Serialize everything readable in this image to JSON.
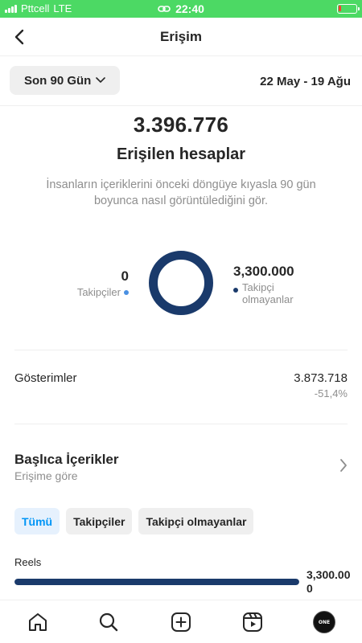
{
  "status_bar": {
    "carrier": "Pttcell",
    "network": "LTE",
    "time": "22:40",
    "link_icon": "link-icon",
    "battery_level": 0.08
  },
  "header": {
    "title": "Erişim",
    "back_icon": "back-chevron-icon"
  },
  "filter": {
    "range_label": "Son 90 Gün",
    "date_range": "22 May - 19 Ağu"
  },
  "summary": {
    "total": "3.396.776",
    "label": "Erişilen hesaplar",
    "description": "İnsanların içeriklerini önceki döngüye kıyasla 90 gün boyunca nasıl görüntülediğini gör."
  },
  "breakdown": {
    "followers_value": "0",
    "followers_label": "Takipçiler",
    "non_followers_value": "3,300.000",
    "non_followers_label": "Takipçi olmayanlar",
    "followers_color": "#4a90e2",
    "non_followers_color": "#1a3a6b"
  },
  "impressions": {
    "label": "Gösterimler",
    "value": "3.873.718",
    "change": "-51,4%"
  },
  "top_content": {
    "title": "Başlıca İçerikler",
    "subtitle": "Erişime göre"
  },
  "chips": [
    "Tümü",
    "Takipçiler",
    "Takipçi olmayanlar"
  ],
  "active_chip": "Tümü",
  "reels": {
    "label": "Reels",
    "value": "3,300.000",
    "fill_fraction": 1.0
  },
  "tab_bar": {
    "tabs": [
      "home-icon",
      "search-icon",
      "create-icon",
      "reels-icon",
      "profile-avatar"
    ],
    "avatar_text": "ONE"
  }
}
